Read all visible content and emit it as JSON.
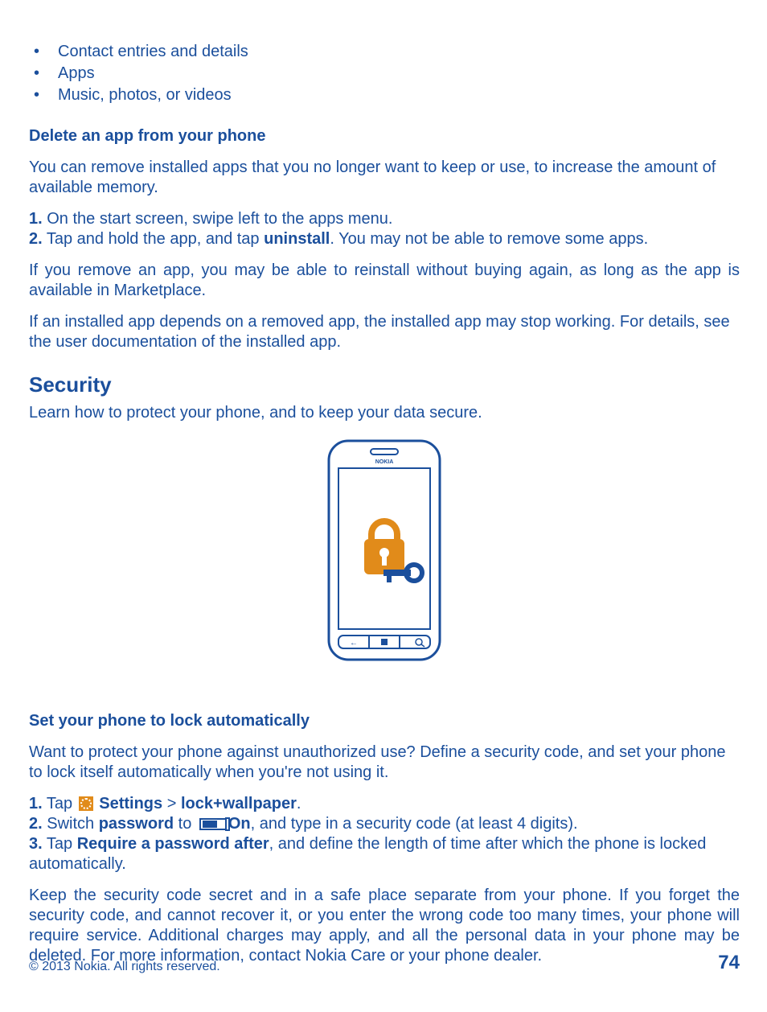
{
  "bullets": [
    "Contact entries and details",
    "Apps",
    "Music, photos, or videos"
  ],
  "delete": {
    "heading": "Delete an app from your phone",
    "intro": "You can remove installed apps that you no longer want to keep or use, to increase the amount of available memory.",
    "step1_num": "1.",
    "step1_text": " On the start screen, swipe left to the apps menu.",
    "step2_num": "2.",
    "step2_text_a": " Tap and hold the app, and tap ",
    "step2_bold": "uninstall",
    "step2_text_b": ". You may not be able to remove some apps.",
    "para_reinstall": "If you remove an app, you may be able to reinstall without buying again, as long as the app is available in Marketplace.",
    "para_depends": "If an installed app depends on a removed app, the installed app may stop working. For details, see the user documentation of the installed app."
  },
  "security": {
    "heading": "Security",
    "intro": "Learn how to protect your phone, and to keep your data secure."
  },
  "autolock": {
    "heading": "Set your phone to lock automatically",
    "intro": "Want to protect your phone against unauthorized use? Define a security code, and set your phone to lock itself automatically when you're not using it.",
    "step1_num": "1.",
    "step1_tap": " Tap ",
    "step1_settings": "Settings",
    "step1_gt": " > ",
    "step1_lock": "lock+wallpaper",
    "step1_dot": ".",
    "step2_num": "2.",
    "step2_switch": " Switch ",
    "step2_password": "password",
    "step2_to": " to ",
    "step2_on": "On",
    "step2_rest": ", and type in a security code (at least 4 digits).",
    "step3_num": "3.",
    "step3_tap": " Tap ",
    "step3_req": "Require a password after",
    "step3_rest": ", and define the length of time after which the phone is locked automatically.",
    "warning": "Keep the security code secret and in a safe place separate from your phone. If you forget the security code, and cannot recover it, or you enter the wrong code too many times, your phone will require service. Additional charges may apply, and all the personal data in your phone may be deleted. For more information, contact Nokia Care or your phone dealer."
  },
  "footer": {
    "copyright": "© 2013 Nokia. All rights reserved.",
    "page": "74"
  }
}
